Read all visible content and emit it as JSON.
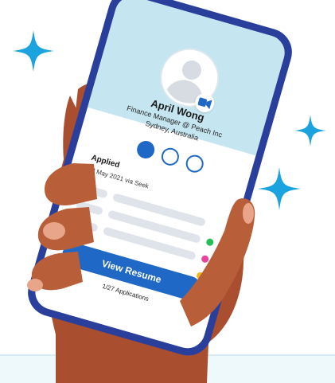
{
  "profile": {
    "name": "April Wong",
    "role": "Finance Manager @ Peach Inc",
    "location": "Sydney, Australia"
  },
  "progress": {
    "steps": 3,
    "current": 1
  },
  "application": {
    "status": "Applied",
    "date": "18 May 2021 via Seek"
  },
  "actions": {
    "view_resume": "View Resume",
    "count": "1/27 Applications"
  },
  "icons": {
    "avatar": "person-placeholder-icon",
    "badge": "video-camera-icon",
    "sparkles": "sparkle-icon"
  },
  "colors": {
    "phone_frame": "#2a3f9c",
    "header": "#c5e6f1",
    "primary": "#1f68c6",
    "sparkle": "#1aa3de",
    "skin": "#b85f39",
    "status_green": "#23c05a",
    "status_pink": "#e8449a",
    "status_yellow": "#f2b619"
  }
}
